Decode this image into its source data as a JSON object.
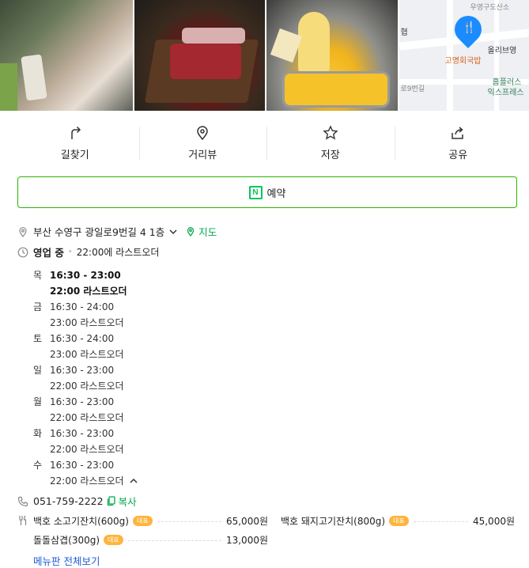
{
  "photos": {
    "items": [
      {
        "name": "grill-photo"
      },
      {
        "name": "meat-platter-photo"
      },
      {
        "name": "cheese-photo"
      }
    ],
    "map": {
      "labels": [
        "고명회국밥",
        "올리브영",
        "홈플러스",
        "익스프레스",
        "로9번길",
        "협",
        "우영구도산소"
      ]
    }
  },
  "actions": [
    {
      "label": "길찾기",
      "icon": "directions-icon"
    },
    {
      "label": "거리뷰",
      "icon": "street-view-icon"
    },
    {
      "label": "저장",
      "icon": "star-icon"
    },
    {
      "label": "공유",
      "icon": "share-icon"
    }
  ],
  "reserve": {
    "label": "예약",
    "icon_text": "N"
  },
  "address": {
    "text": "부산 수영구 광일로9번길 4 1층",
    "map_link": "지도"
  },
  "business": {
    "status": "영업 중",
    "last_order": "22:00에 라스트오더"
  },
  "hours": [
    {
      "day": "목",
      "time": "16:30 - 23:00",
      "last": "22:00 라스트오더",
      "today": true
    },
    {
      "day": "금",
      "time": "16:30 - 24:00",
      "last": "23:00 라스트오더"
    },
    {
      "day": "토",
      "time": "16:30 - 24:00",
      "last": "23:00 라스트오더"
    },
    {
      "day": "일",
      "time": "16:30 - 23:00",
      "last": "22:00 라스트오더"
    },
    {
      "day": "월",
      "time": "16:30 - 23:00",
      "last": "22:00 라스트오더"
    },
    {
      "day": "화",
      "time": "16:30 - 23:00",
      "last": "22:00 라스트오더"
    },
    {
      "day": "수",
      "time": "16:30 - 23:00",
      "last": "22:00 라스트오더"
    }
  ],
  "phone": {
    "number": "051-759-2222",
    "copy_label": "복사"
  },
  "menu": {
    "items": [
      {
        "name": "백호 소고기잔치(600g)",
        "badge": "대표",
        "price": "65,000원"
      },
      {
        "name": "백호 돼지고기잔치(800g)",
        "badge": "대표",
        "price": "45,000원"
      },
      {
        "name": "돌돌삼겹(300g)",
        "badge": "대표",
        "price": "13,000원"
      }
    ],
    "more_label": "메뉴판 전체보기"
  },
  "colors": {
    "accent_green": "#03c75a",
    "link_blue": "#1f5cd7",
    "badge_orange": "#ffb43c",
    "map_pin": "#1a8cff"
  }
}
